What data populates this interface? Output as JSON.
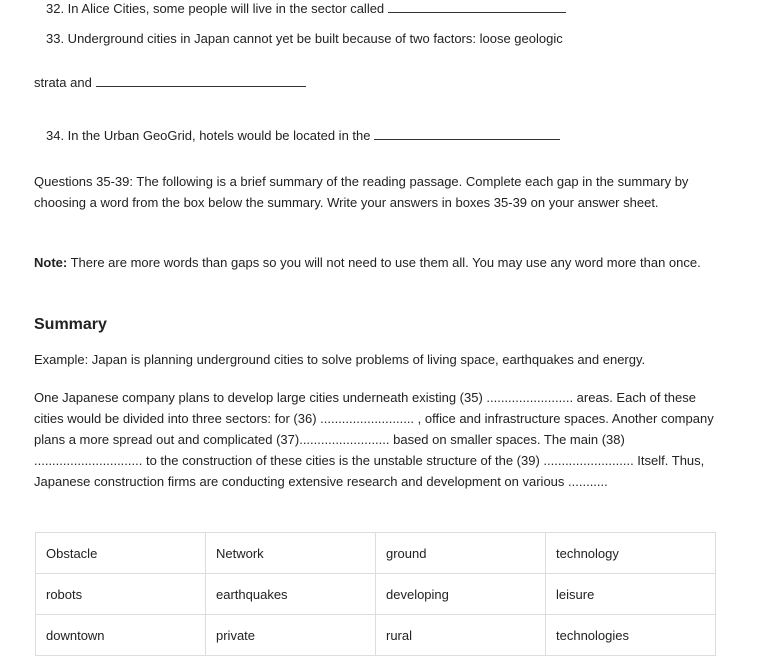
{
  "questions": {
    "q32": "32. In Alice Cities, some people will live in the sector called",
    "q33_line1": "33. Underground cities in Japan cannot yet be built because of two factors: loose geologic",
    "q33_line2": "strata and",
    "q34": "34. In the Urban GeoGrid, hotels would be located in the"
  },
  "instructions": {
    "intro": "Questions 35-39: The following is a brief summary of the reading passage. Complete each gap in the summary by choosing a word from the box below the summary. Write your answers in boxes 35-39 on your answer sheet.",
    "note_label": "Note:",
    "note_text": " There are more words than gaps so you will not need to use them all. You may use any word more than once."
  },
  "summary": {
    "heading": "Summary",
    "example": "Example: Japan is planning underground cities to solve problems of living space, earthquakes and energy.",
    "body": "One Japanese company plans to develop large cities underneath existing (35) ........................ areas. Each of these cities would be divided into three sectors: for (36) .......................... , office and infrastructure  spaces. Another company plans a more spread out and complicated (37)......................... based on smaller spaces. The main (38) .............................. to the construction of these cities is the unstable structure of the (39) ......................... Itself.  Thus, Japanese construction firms are conducting extensive research and development on various ..........."
  },
  "word_box": {
    "rows": [
      [
        "Obstacle",
        "Network",
        "ground",
        "technology"
      ],
      [
        "robots",
        "earthquakes",
        "developing",
        "leisure"
      ],
      [
        "downtown",
        "private",
        "rural",
        "technologies"
      ]
    ]
  }
}
